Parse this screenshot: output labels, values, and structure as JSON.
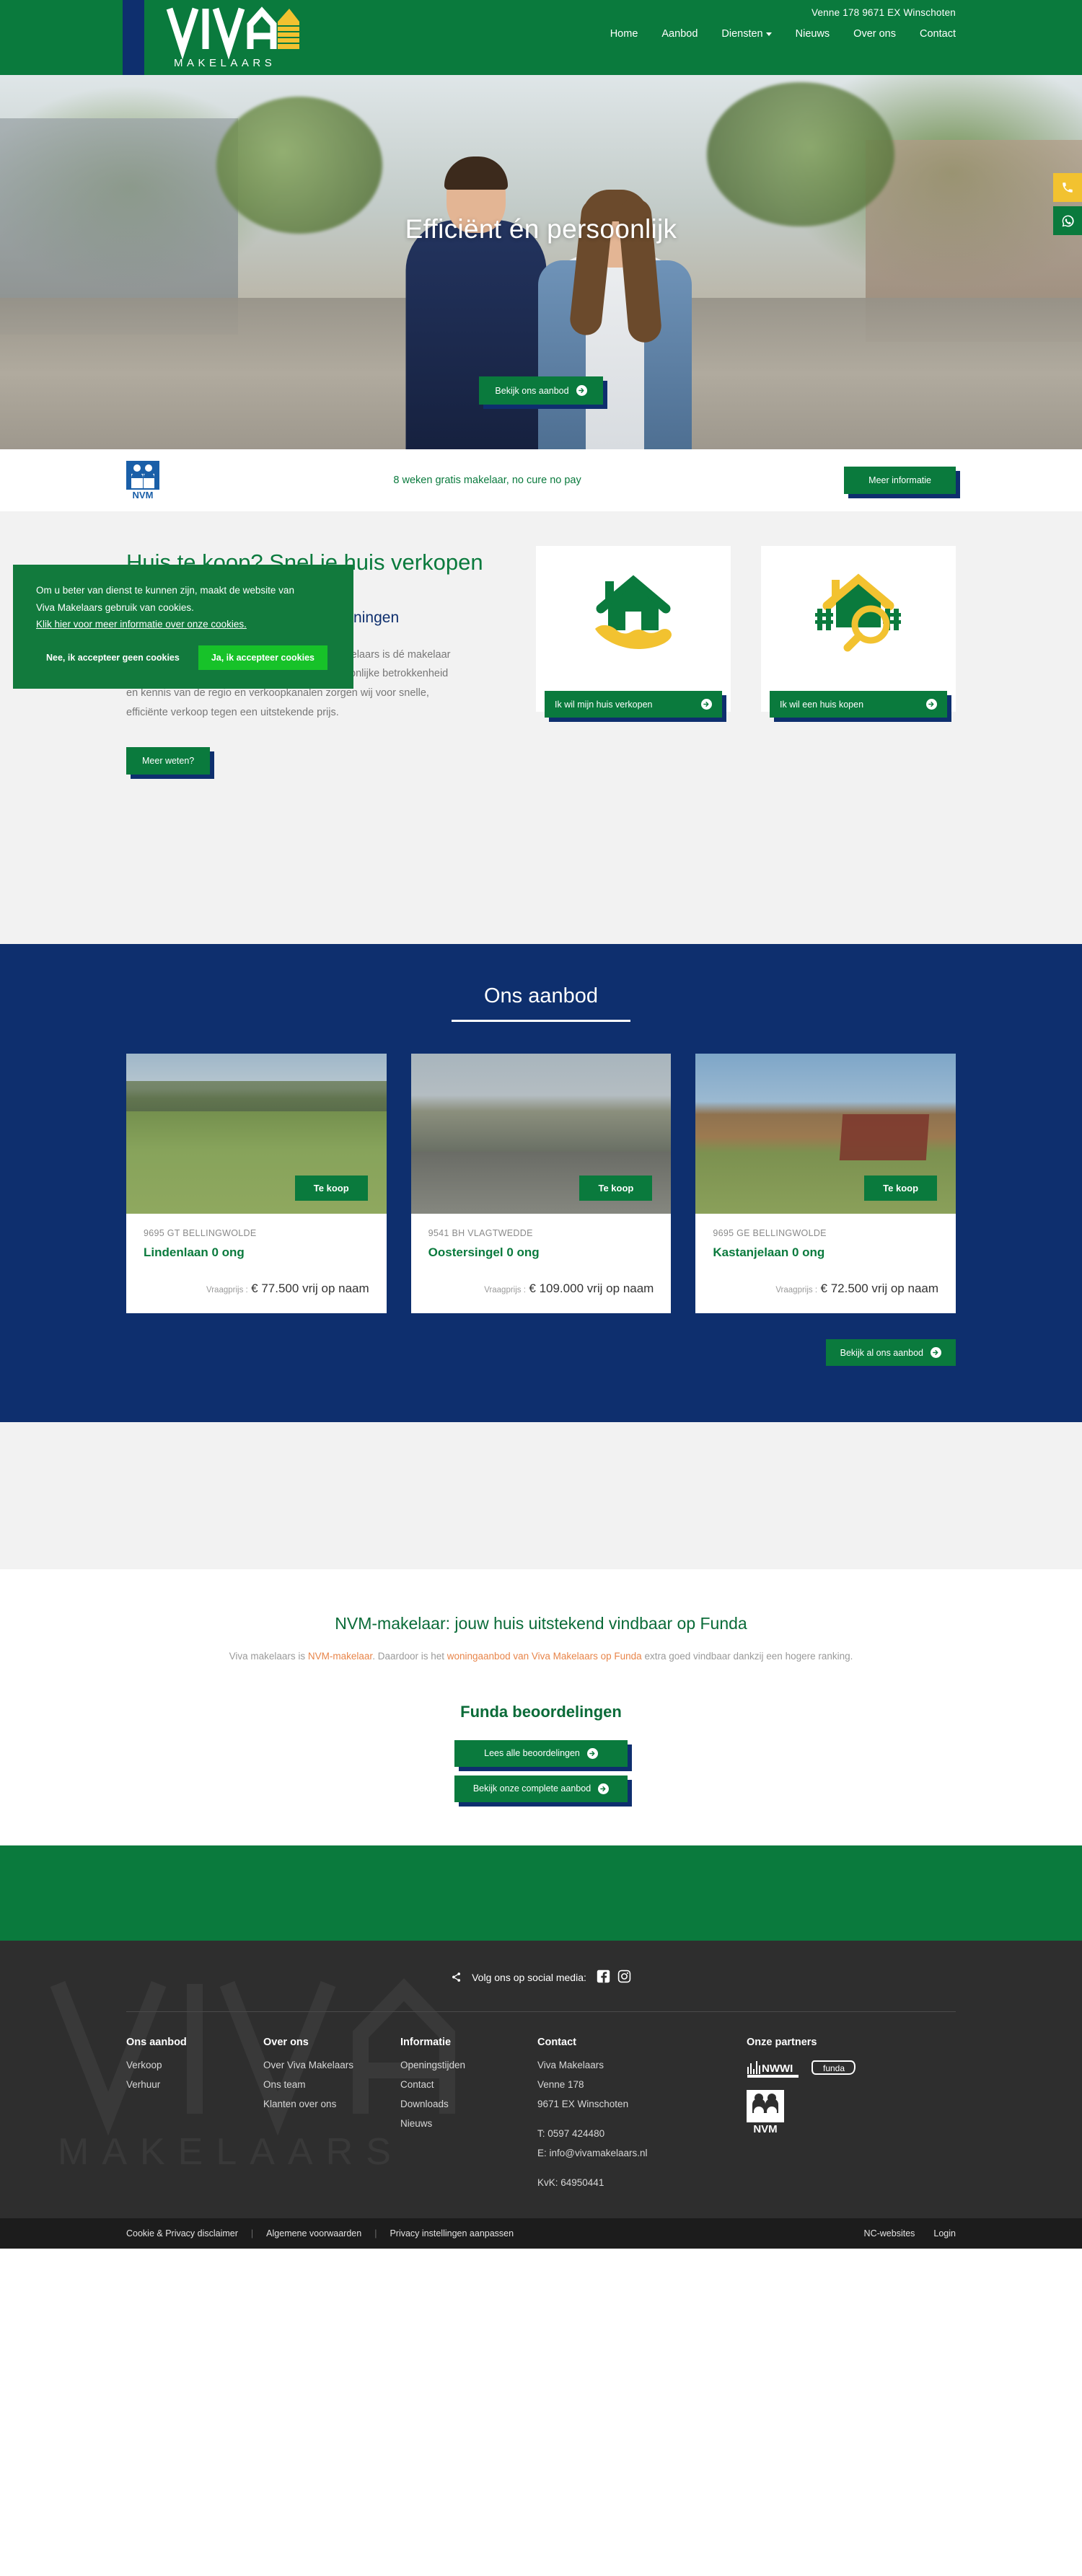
{
  "header": {
    "address": "Venne 178 9671 EX Winschoten",
    "logo_word": "VIVA",
    "logo_sub": "MAKELAARS",
    "nav": [
      {
        "label": "Home",
        "dropdown": false
      },
      {
        "label": "Aanbod",
        "dropdown": false
      },
      {
        "label": "Diensten",
        "dropdown": true
      },
      {
        "label": "Nieuws",
        "dropdown": false
      },
      {
        "label": "Over ons",
        "dropdown": false
      },
      {
        "label": "Contact",
        "dropdown": false
      }
    ]
  },
  "hero": {
    "title": "Efficiënt én persoonlijk",
    "cta_label": "Bekijk ons aanbod"
  },
  "side_float": {
    "phone_icon": "phone-icon",
    "whatsapp_icon": "whatsapp-icon"
  },
  "nvm_strip": {
    "logo_alt": "NVM",
    "text": "8 weken gratis makelaar, no cure no pay",
    "button_label": "Meer informatie"
  },
  "intro": {
    "heading": "Huis te koop? Snel je huis verkopen met Viva Makelaars",
    "subheading": "Uw NVM-makelaar voor Oost-Groningen",
    "body": "Wilt u uw huis snel en goed verkopen? Viva Makelaars is dé makelaar voor Oldambt en Westerwolde. Door onze persoonlijke betrokkenheid en kennis van de regio en verkoopkanalen zorgen wij voor snelle, efficiënte verkoop tegen een uitstekende prijs.",
    "cta_label": "Meer weten?",
    "cards": [
      {
        "icon": "house-in-hand-icon",
        "label": "Ik wil mijn huis verkopen"
      },
      {
        "icon": "house-search-icon",
        "label": "Ik wil een huis kopen"
      }
    ]
  },
  "cookie": {
    "text_line1": "Om u beter van dienst te kunnen zijn, maakt de website van",
    "text_line2": "Viva Makelaars gebruik van cookies.",
    "link": "Klik hier voor meer informatie over onze cookies.",
    "deny_label": "Nee, ik accepteer geen cookies",
    "accept_label": "Ja, ik accepteer cookies",
    "accept_color": "#17c229",
    "bg_color": "#127a3d"
  },
  "aanbod": {
    "title": "Ons aanbod",
    "badge_label": "Te koop",
    "price_prefix": "Vraagprijs :",
    "cta_label": "Bekijk al ons aanbod",
    "properties": [
      {
        "zip_city": "9695 GT BELLINGWOLDE",
        "street": "Lindenlaan 0 ong",
        "price": "€ 77.500 vrij op naam"
      },
      {
        "zip_city": "9541 BH VLAGTWEDDE",
        "street": "Oostersingel 0 ong",
        "price": "€ 109.000 vrij op naam"
      },
      {
        "zip_city": "9695 GE BELLINGWOLDE",
        "street": "Kastanjelaan 0 ong",
        "price": "€ 72.500 vrij op naam"
      }
    ]
  },
  "funda": {
    "heading": "NVM-makelaar: jouw huis uitstekend vindbaar op Funda",
    "para_part1": "Viva makelaars is ",
    "link1": "NVM-makelaar",
    "para_part2": ". Daardoor is het ",
    "link2": "woningaanbod van Viva Makelaars op Funda",
    "para_part3": " extra goed vindbaar dankzij een hogere ranking.",
    "reviews_heading": "Funda beoordelingen",
    "btn_reviews": "Lees alle beoordelingen",
    "btn_offer": "Bekijk onze complete aanbod"
  },
  "footer": {
    "social_label": "Volg ons op social media:",
    "social_icons": [
      "share-icon",
      "facebook-icon",
      "instagram-icon"
    ],
    "columns": [
      {
        "title": "Ons aanbod",
        "items": [
          "Verkoop",
          "Verhuur"
        ]
      },
      {
        "title": "Over ons",
        "items": [
          "Over Viva Makelaars",
          "Ons team",
          "Klanten over ons"
        ]
      },
      {
        "title": "Informatie",
        "items": [
          "Openingstijden",
          "Contact",
          "Downloads",
          "Nieuws"
        ]
      }
    ],
    "contact": {
      "title": "Contact",
      "company": "Viva Makelaars",
      "street": "Venne 178",
      "city": "9671 EX Winschoten",
      "phone": "T: 0597 424480",
      "email": "E: info@vivamakelaars.nl",
      "kvk": "KvK: 64950441"
    },
    "partners": {
      "title": "Onze partners",
      "logos": [
        "nwwi-logo",
        "funda-logo",
        "nvm-logo"
      ]
    },
    "bottom": {
      "links": [
        "Cookie & Privacy disclaimer",
        "Algemene voorwaarden",
        "Privacy instellingen aanpassen"
      ],
      "right_links": [
        "NC-websites",
        "Login"
      ]
    }
  },
  "colors": {
    "green": "#0a7a3d",
    "navy": "#0e2f6e",
    "yellow": "#f2c230",
    "orange_link": "#e8854a",
    "footer_dark": "#2e2e2e"
  }
}
